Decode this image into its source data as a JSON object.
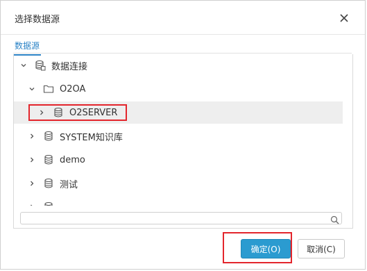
{
  "dialog": {
    "title": "选择数据源",
    "close_icon": "close-icon"
  },
  "tabs": [
    {
      "label": "数据源",
      "active": true
    }
  ],
  "tree": {
    "nodes": [
      {
        "label": "数据连接",
        "icon": "database-folder-icon",
        "level": 0,
        "expanded": true
      },
      {
        "label": "O2OA",
        "icon": "folder-icon",
        "level": 1,
        "expanded": true
      },
      {
        "label": "O2SERVER",
        "icon": "database-icon",
        "level": 2,
        "expanded": false,
        "selected": true
      },
      {
        "label": "SYSTEM知识库",
        "icon": "database-icon",
        "level": 1,
        "expanded": false
      },
      {
        "label": "demo",
        "icon": "database-icon",
        "level": 1,
        "expanded": false
      },
      {
        "label": "测试",
        "icon": "database-icon",
        "level": 1,
        "expanded": false
      },
      {
        "label": "",
        "icon": "database-icon",
        "level": 1,
        "expanded": false,
        "partially_visible": true
      }
    ]
  },
  "search": {
    "value": "",
    "placeholder": "",
    "icon": "search-icon"
  },
  "buttons": {
    "ok_label": "确定(O)",
    "cancel_label": "取消(C)"
  },
  "colors": {
    "accent": "#2b9bd0",
    "tab_active": "#2b83c6",
    "annotation_red": "#e3252c",
    "selected_row": "#eeeeee"
  }
}
